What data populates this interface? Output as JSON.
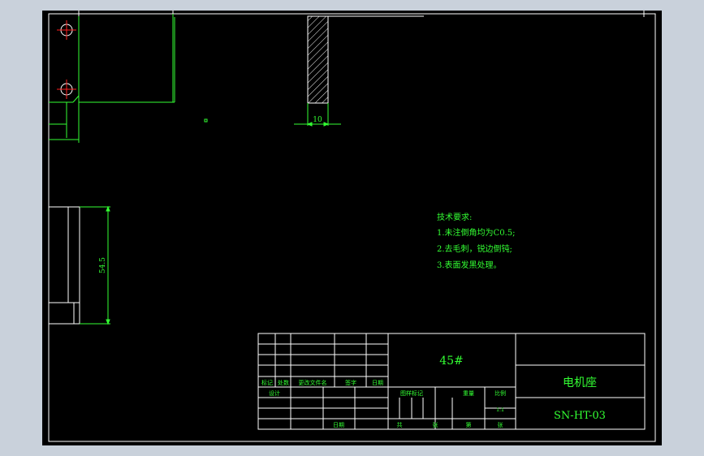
{
  "drawing": {
    "dimension_width": "10",
    "dimension_height": "54.5",
    "tech_requirements": {
      "title": "技术要求:",
      "items": [
        "1.未注倒角均为C0.5;",
        "2.去毛刺，锐边倒钝;",
        "3.表面发黑处理。"
      ]
    },
    "title_block": {
      "material": "45#",
      "part_name": "电机座",
      "drawing_number": "SN-HT-03",
      "scale_value": "1:1",
      "labels": {
        "mark": "标记",
        "count": "处数",
        "change_doc": "更改文件名",
        "signature": "签字",
        "date": "日期",
        "design": "设计",
        "approval_date": "日期",
        "stage_mark": "图样标记",
        "weight": "重量",
        "scale": "比例",
        "total_sheets": "共",
        "sheet": "张",
        "page_no": "第",
        "page": "张"
      }
    }
  },
  "colors": {
    "background": "#000000",
    "frame": "#ffffff",
    "geometry": "#33ff33",
    "center_mark": "#ff2020",
    "chrome": "#c9d1db"
  }
}
